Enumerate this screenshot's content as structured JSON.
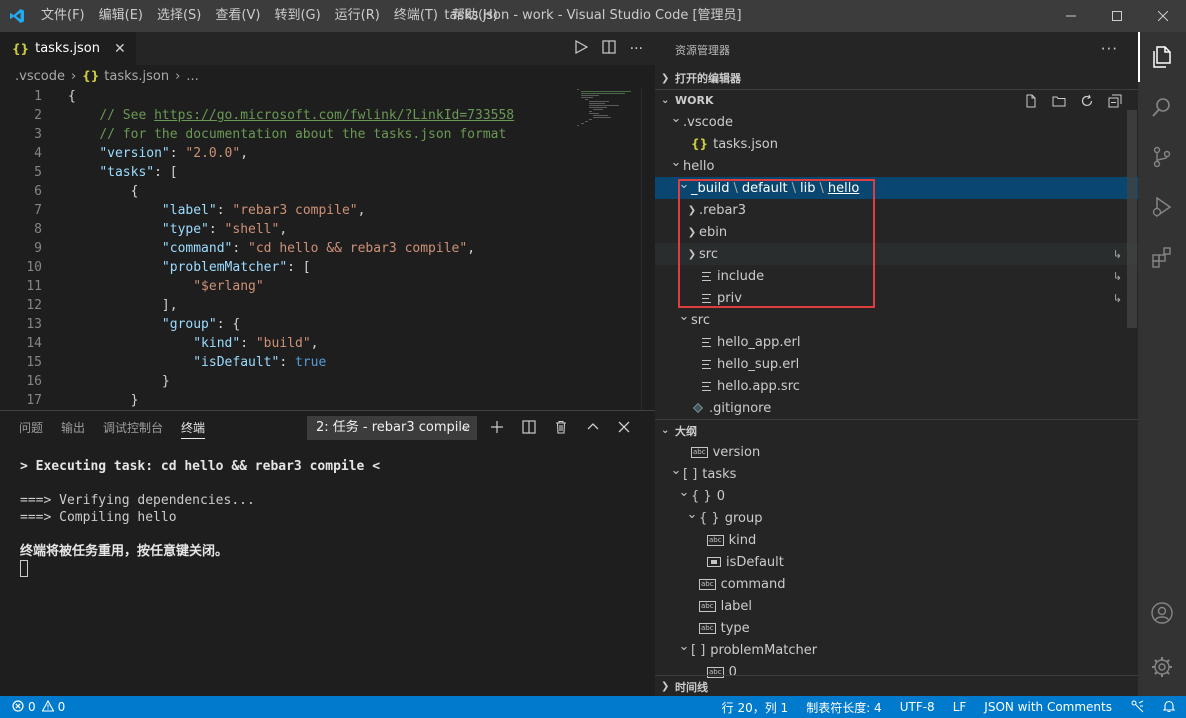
{
  "titlebar": {
    "menu": [
      "文件(F)",
      "编辑(E)",
      "选择(S)",
      "查看(V)",
      "转到(G)",
      "运行(R)",
      "终端(T)",
      "帮助(H)"
    ],
    "window_title": "tasks.json - work - Visual Studio Code [管理员]"
  },
  "editor": {
    "tab": {
      "icon": "{}",
      "label": "tasks.json"
    },
    "breadcrumb": {
      "folder": ".vscode",
      "file": "tasks.json",
      "more": "..."
    },
    "lines": [
      {
        "n": "1",
        "html": "{"
      },
      {
        "n": "2",
        "html": "    <span class=\"c\">// See </span><span class=\"u\">https://go.microsoft.com/fwlink/?LinkId=733558</span>"
      },
      {
        "n": "3",
        "html": "    <span class=\"c\">// for the documentation about the tasks.json format</span>"
      },
      {
        "n": "4",
        "html": "    <span class=\"k\">\"version\"</span>: <span class=\"s\">\"2.0.0\"</span>,"
      },
      {
        "n": "5",
        "html": "    <span class=\"k\">\"tasks\"</span>: ["
      },
      {
        "n": "6",
        "html": "        {"
      },
      {
        "n": "7",
        "html": "            <span class=\"k\">\"label\"</span>: <span class=\"s\">\"rebar3 compile\"</span>,"
      },
      {
        "n": "8",
        "html": "            <span class=\"k\">\"type\"</span>: <span class=\"s\">\"shell\"</span>,"
      },
      {
        "n": "9",
        "html": "            <span class=\"k\">\"command\"</span>: <span class=\"s\">\"cd hello &amp;&amp; rebar3 compile\"</span>,"
      },
      {
        "n": "10",
        "html": "            <span class=\"k\">\"problemMatcher\"</span>: ["
      },
      {
        "n": "11",
        "html": "                <span class=\"s\">\"$erlang\"</span>"
      },
      {
        "n": "12",
        "html": "            ],"
      },
      {
        "n": "13",
        "html": "            <span class=\"k\">\"group\"</span>: {"
      },
      {
        "n": "14",
        "html": "                <span class=\"k\">\"kind\"</span>: <span class=\"s\">\"build\"</span>,"
      },
      {
        "n": "15",
        "html": "                <span class=\"k\">\"isDefault\"</span>: <span class=\"b\">true</span>"
      },
      {
        "n": "16",
        "html": "            }"
      },
      {
        "n": "17",
        "html": "        }"
      }
    ]
  },
  "panel": {
    "tabs": [
      "问题",
      "输出",
      "调试控制台",
      "终端"
    ],
    "active_tab": "终端",
    "terminal_select": "2: 任务 - rebar3 compile",
    "terminal_lines": [
      {
        "text": "> Executing task: cd hello && rebar3 compile <",
        "bold": true
      },
      {
        "text": "",
        "bold": false
      },
      {
        "text": "===> Verifying dependencies...",
        "bold": false
      },
      {
        "text": "===> Compiling hello",
        "bold": false
      },
      {
        "text": "",
        "bold": false
      },
      {
        "text": "终端将被任务重用，按任意键关闭。",
        "bold": true
      }
    ]
  },
  "sidebar": {
    "header": "资源管理器",
    "open_editors": "打开的编辑器",
    "workspace": "WORK",
    "tree": [
      {
        "label": ".vscode",
        "indent": 1,
        "arrow": "v",
        "icon": ""
      },
      {
        "label": "tasks.json",
        "indent": 2,
        "arrow": "",
        "icon": "json"
      },
      {
        "label": "hello",
        "indent": 1,
        "arrow": "v",
        "icon": ""
      },
      {
        "label": "_build",
        "indent": 2,
        "arrow": "v",
        "icon": "",
        "compact": [
          "default",
          "lib",
          "hello"
        ],
        "selected": true
      },
      {
        "label": ".rebar3",
        "indent": 3,
        "arrow": ">",
        "icon": ""
      },
      {
        "label": "ebin",
        "indent": 3,
        "arrow": ">",
        "icon": ""
      },
      {
        "label": "src",
        "indent": 3,
        "arrow": ">",
        "icon": "",
        "link": true,
        "hover": true
      },
      {
        "label": "include",
        "indent": 3,
        "arrow": "",
        "icon": "lines",
        "link": true
      },
      {
        "label": "priv",
        "indent": 3,
        "arrow": "",
        "icon": "lines",
        "link": true
      },
      {
        "label": "src",
        "indent": 2,
        "arrow": "v",
        "icon": ""
      },
      {
        "label": "hello_app.erl",
        "indent": 3,
        "arrow": "",
        "icon": "lines"
      },
      {
        "label": "hello_sup.erl",
        "indent": 3,
        "arrow": "",
        "icon": "lines"
      },
      {
        "label": "hello.app.src",
        "indent": 3,
        "arrow": "",
        "icon": "lines"
      },
      {
        "label": ".gitignore",
        "indent": 2,
        "arrow": "",
        "icon": "git"
      }
    ],
    "outline": "大纲",
    "outline_items": [
      {
        "label": "version",
        "indent": 2,
        "arrow": "",
        "icon": "abc"
      },
      {
        "label": "tasks",
        "indent": 1,
        "arrow": "v",
        "icon": "arr"
      },
      {
        "label": "0",
        "indent": 2,
        "arrow": "v",
        "icon": "obj"
      },
      {
        "label": "group",
        "indent": 3,
        "arrow": "v",
        "icon": "obj"
      },
      {
        "label": "kind",
        "indent": 4,
        "arrow": "",
        "icon": "abc"
      },
      {
        "label": "isDefault",
        "indent": 4,
        "arrow": "",
        "icon": "bool"
      },
      {
        "label": "command",
        "indent": 3,
        "arrow": "",
        "icon": "abc"
      },
      {
        "label": "label",
        "indent": 3,
        "arrow": "",
        "icon": "abc"
      },
      {
        "label": "type",
        "indent": 3,
        "arrow": "",
        "icon": "abc"
      },
      {
        "label": "problemMatcher",
        "indent": 2,
        "arrow": "v",
        "icon": "arr"
      },
      {
        "label": "0",
        "indent": 4,
        "arrow": "",
        "icon": "abc"
      }
    ],
    "timeline": "时间线"
  },
  "statusbar": {
    "errors": "0",
    "warnings": "0",
    "position": "行 20，列 1",
    "tab_size": "制表符长度: 4",
    "encoding": "UTF-8",
    "eol": "LF",
    "language": "JSON with Comments"
  },
  "colors": {
    "accent": "#007acc",
    "selection": "#094771",
    "highlight_box": "#e03e3e"
  }
}
